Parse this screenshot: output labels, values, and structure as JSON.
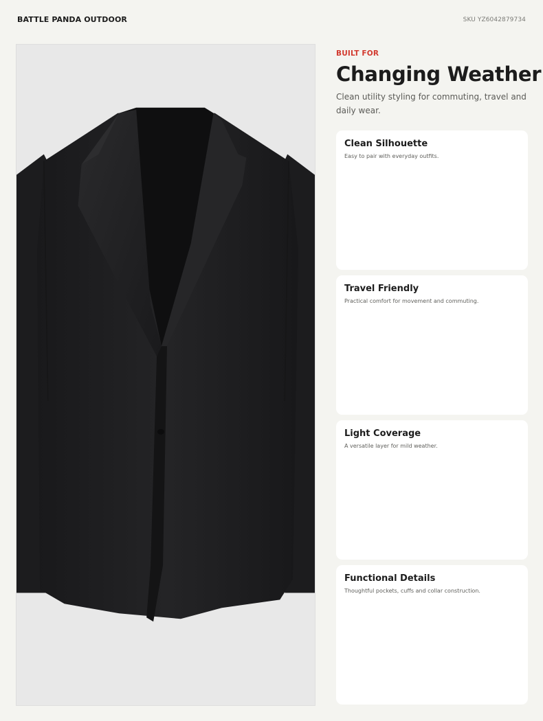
{
  "header": {
    "brand": "BATTLE PANDA OUTDOOR",
    "sku": "SKU YZ6042879734"
  },
  "hero": {
    "image_subject": "black blazer product photo",
    "background_color": "#e8e8e8",
    "garment_color": "#1f1f21"
  },
  "intro": {
    "eyebrow": "BUILT FOR",
    "headline": "Changing Weather",
    "subtitle": "Clean utility styling for commuting, travel and daily wear."
  },
  "features": [
    {
      "title": "Clean Silhouette",
      "description": "Easy to pair with everyday outfits."
    },
    {
      "title": "Travel Friendly",
      "description": "Practical comfort for movement and commuting."
    },
    {
      "title": "Light Coverage",
      "description": "A versatile layer for mild weather."
    },
    {
      "title": "Functional Details",
      "description": "Thoughtful pockets, cuffs and collar construction."
    }
  ],
  "colors": {
    "accent": "#d23a2f",
    "page_background": "#f4f4f0",
    "card_background": "#ffffff"
  }
}
